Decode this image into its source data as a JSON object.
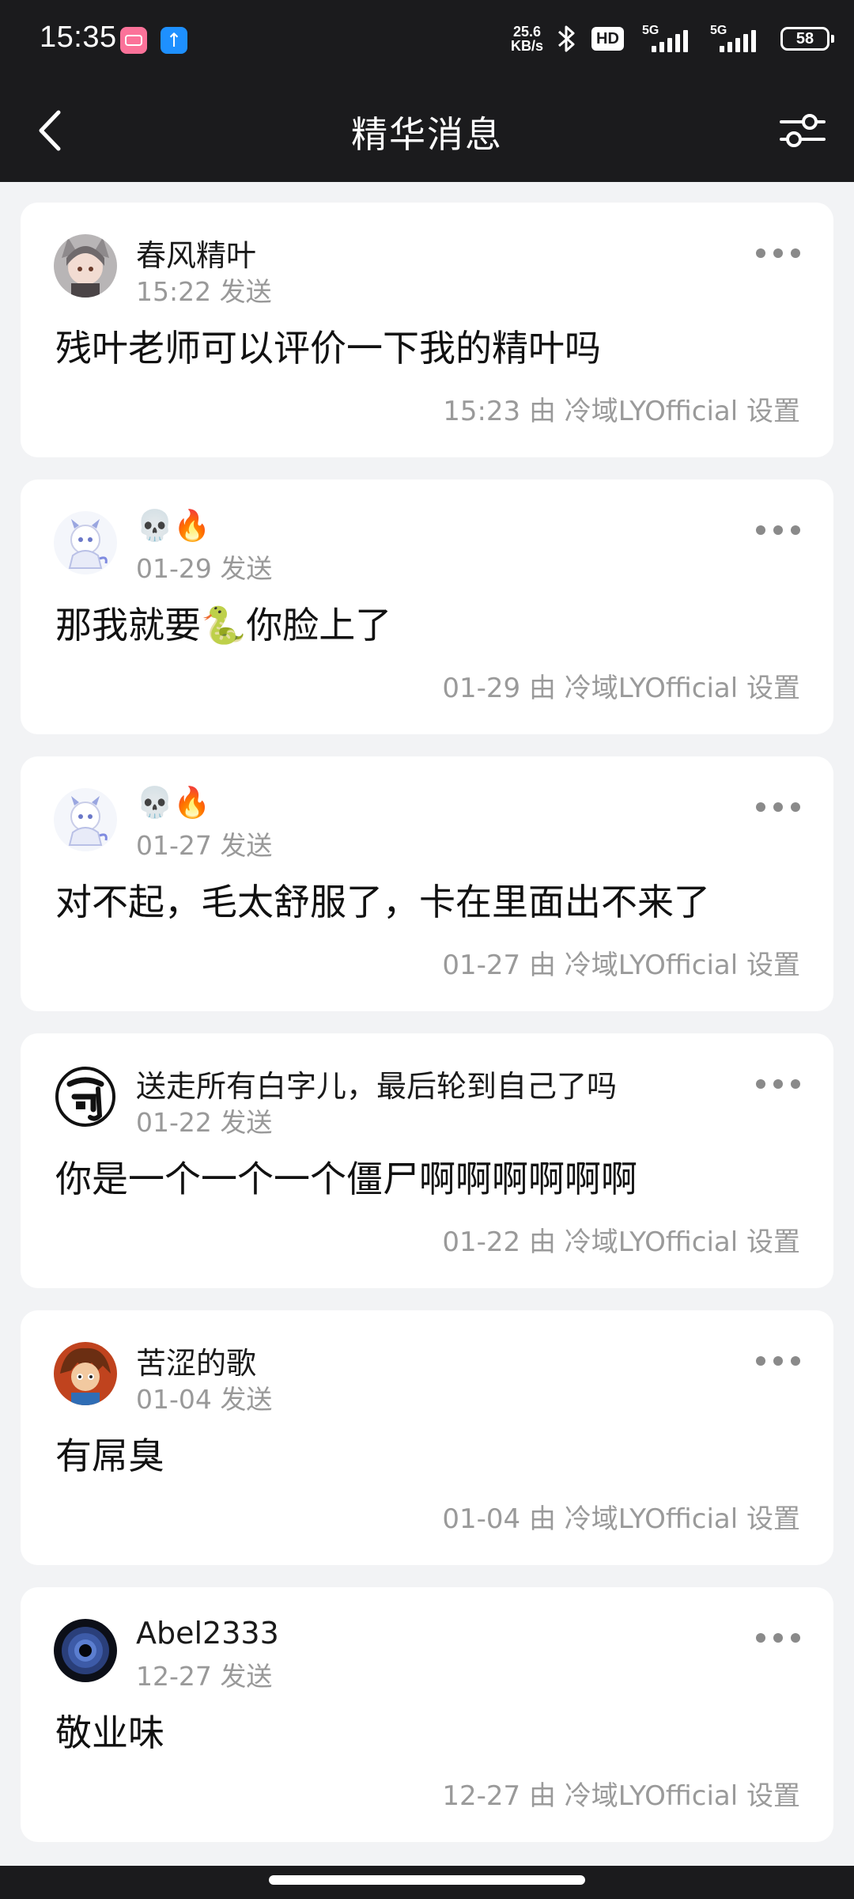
{
  "status_bar": {
    "time": "15:35",
    "net_speed_value": "25.6",
    "net_speed_unit": "KB/s",
    "hd_label": "HD",
    "signal1_label": "5G",
    "signal2_label": "5G",
    "battery": "58"
  },
  "header": {
    "title": "精华消息",
    "back_icon": "back-arrow",
    "filter_icon": "settings-sliders"
  },
  "colors": {
    "header_bg": "#1b1b1d",
    "page_bg": "#f2f3f5",
    "card_bg": "#ffffff",
    "muted_text": "#999999"
  },
  "messages": [
    {
      "username": "春风精叶",
      "send_time": "15:22 发送",
      "text": "残叶老师可以评价一下我的精叶吗",
      "set_info": "15:23 由 冷域LYOfficial 设置"
    },
    {
      "username": "💀🔥",
      "send_time": "01-29 发送",
      "text": "那我就要🐍你脸上了",
      "set_info": "01-29 由 冷域LYOfficial 设置"
    },
    {
      "username": "💀🔥",
      "send_time": "01-27 发送",
      "text": "对不起，毛太舒服了，卡在里面出不来了",
      "set_info": "01-27 由 冷域LYOfficial 设置"
    },
    {
      "username": "送走所有白字儿，最后轮到自己了吗",
      "send_time": "01-22 发送",
      "text": "你是一个一个一个僵尸啊啊啊啊啊啊",
      "set_info": "01-22 由 冷域LYOfficial 设置"
    },
    {
      "username": "苦涩的歌",
      "send_time": "01-04 发送",
      "text": "有屌臭",
      "set_info": "01-04 由 冷域LYOfficial 设置"
    },
    {
      "username": "Abel2333",
      "send_time": "12-27 发送",
      "text": "敬业味",
      "set_info": "12-27 由 冷域LYOfficial 设置"
    }
  ]
}
